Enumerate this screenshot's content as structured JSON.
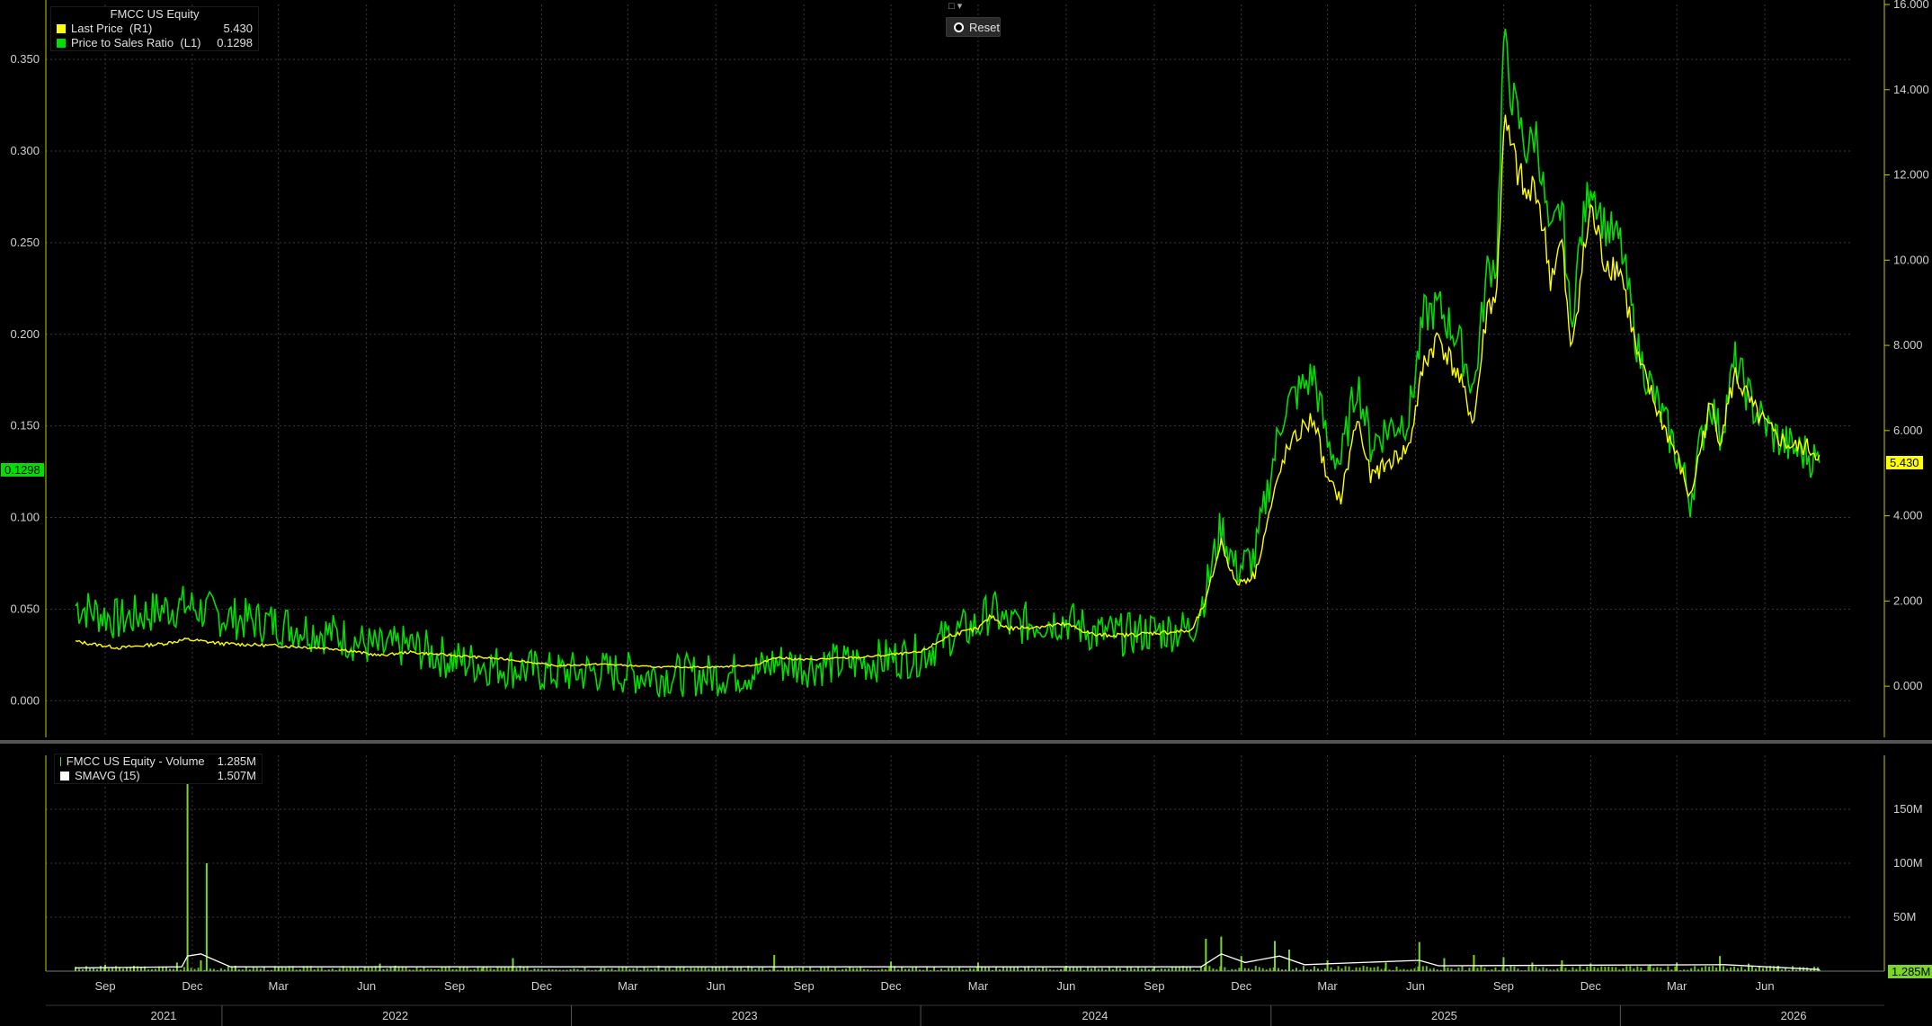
{
  "price_legend": {
    "title": "FMCC US Equity",
    "rows": [
      {
        "label": "Last Price  (R1)",
        "value": "5.430",
        "color": "#ffff00"
      },
      {
        "label": "Price to Sales Ratio  (L1)",
        "value": "0.1298",
        "color": "#00e000"
      }
    ]
  },
  "volume_legend": {
    "rows": [
      {
        "label": "FMCC US Equity - Volume",
        "value": "1.285M",
        "color": "#7cd62a"
      },
      {
        "label": "SMAVG (15)",
        "value": "1.507M",
        "color": "#ffffff"
      }
    ]
  },
  "toolbar": {
    "reset_label": "Reset"
  },
  "badges": {
    "left_value": "0.1298",
    "right_value": "5.430",
    "volume_value": "1.285M"
  },
  "colors": {
    "price": "#ffff00",
    "ps_ratio": "#00e000",
    "volume": "#7cd62a",
    "smavg": "#ffffff",
    "grid": "#3a3a3a",
    "axis": "#c8c800"
  },
  "chart_data": [
    {
      "type": "line",
      "series": [
        {
          "name": "Last Price  (R1)",
          "axis": "right",
          "points": [
            [
              "2021-08-01",
              1.05
            ],
            [
              "2021-09-15",
              0.9
            ],
            [
              "2021-11-01",
              1.0
            ],
            [
              "2021-11-25",
              1.1
            ],
            [
              "2022-01-01",
              1.0
            ],
            [
              "2022-03-01",
              0.95
            ],
            [
              "2022-05-01",
              0.88
            ],
            [
              "2022-06-15",
              0.72
            ],
            [
              "2022-07-15",
              0.8
            ],
            [
              "2022-09-01",
              0.72
            ],
            [
              "2022-11-01",
              0.62
            ],
            [
              "2022-12-15",
              0.48
            ],
            [
              "2023-02-01",
              0.52
            ],
            [
              "2023-04-01",
              0.45
            ],
            [
              "2023-06-01",
              0.45
            ],
            [
              "2023-07-15",
              0.5
            ],
            [
              "2023-08-01",
              0.68
            ],
            [
              "2023-09-01",
              0.62
            ],
            [
              "2023-11-01",
              0.68
            ],
            [
              "2024-01-01",
              0.8
            ],
            [
              "2024-02-01",
              1.2
            ],
            [
              "2024-03-01",
              1.35
            ],
            [
              "2024-03-15",
              1.65
            ],
            [
              "2024-04-01",
              1.35
            ],
            [
              "2024-05-01",
              1.4
            ],
            [
              "2024-06-01",
              1.45
            ],
            [
              "2024-07-01",
              1.2
            ],
            [
              "2024-08-01",
              1.2
            ],
            [
              "2024-09-01",
              1.25
            ],
            [
              "2024-10-10",
              1.3
            ],
            [
              "2024-10-25",
              2.0
            ],
            [
              "2024-11-10",
              3.4
            ],
            [
              "2024-11-25",
              2.4
            ],
            [
              "2024-12-15",
              2.6
            ],
            [
              "2025-01-01",
              4.2
            ],
            [
              "2025-01-15",
              5.4
            ],
            [
              "2025-02-01",
              6.0
            ],
            [
              "2025-02-15",
              6.3
            ],
            [
              "2025-03-01",
              4.8
            ],
            [
              "2025-03-15",
              4.4
            ],
            [
              "2025-04-01",
              6.3
            ],
            [
              "2025-04-15",
              4.9
            ],
            [
              "2025-05-01",
              5.2
            ],
            [
              "2025-05-25",
              5.6
            ],
            [
              "2025-06-10",
              7.6
            ],
            [
              "2025-06-25",
              8.2
            ],
            [
              "2025-07-15",
              7.3
            ],
            [
              "2025-08-01",
              6.2
            ],
            [
              "2025-08-15",
              8.9
            ],
            [
              "2025-08-25",
              9.2
            ],
            [
              "2025-09-01",
              13.2
            ],
            [
              "2025-09-10",
              12.5
            ],
            [
              "2025-09-25",
              11.4
            ],
            [
              "2025-10-05",
              11.8
            ],
            [
              "2025-10-20",
              9.6
            ],
            [
              "2025-11-01",
              10.4
            ],
            [
              "2025-11-10",
              7.8
            ],
            [
              "2025-11-20",
              9.5
            ],
            [
              "2025-12-01",
              11.2
            ],
            [
              "2025-12-15",
              10.0
            ],
            [
              "2026-01-01",
              9.8
            ],
            [
              "2026-01-20",
              7.6
            ],
            [
              "2026-02-10",
              6.4
            ],
            [
              "2026-03-01",
              5.4
            ],
            [
              "2026-03-15",
              4.4
            ],
            [
              "2026-03-25",
              5.5
            ],
            [
              "2026-04-05",
              6.6
            ],
            [
              "2026-04-15",
              5.8
            ],
            [
              "2026-05-01",
              7.3
            ],
            [
              "2026-05-20",
              6.5
            ],
            [
              "2026-06-10",
              5.9
            ],
            [
              "2026-07-01",
              5.6
            ],
            [
              "2026-07-15",
              5.6
            ],
            [
              "2026-07-28",
              5.43
            ]
          ]
        },
        {
          "name": "Price to Sales Ratio  (L1)",
          "axis": "left",
          "points": [
            [
              "2021-08-01",
              0.052
            ],
            [
              "2021-09-15",
              0.044
            ],
            [
              "2021-11-01",
              0.05
            ],
            [
              "2021-11-25",
              0.052
            ],
            [
              "2022-01-01",
              0.046
            ],
            [
              "2022-03-01",
              0.042
            ],
            [
              "2022-05-01",
              0.036
            ],
            [
              "2022-06-15",
              0.028
            ],
            [
              "2022-07-15",
              0.03
            ],
            [
              "2022-09-01",
              0.022
            ],
            [
              "2022-11-01",
              0.018
            ],
            [
              "2022-12-15",
              0.015
            ],
            [
              "2023-02-01",
              0.016
            ],
            [
              "2023-04-01",
              0.014
            ],
            [
              "2023-06-01",
              0.014
            ],
            [
              "2023-07-15",
              0.016
            ],
            [
              "2023-08-01",
              0.021
            ],
            [
              "2023-09-01",
              0.019
            ],
            [
              "2023-11-01",
              0.021
            ],
            [
              "2024-01-01",
              0.025
            ],
            [
              "2024-02-01",
              0.036
            ],
            [
              "2024-03-01",
              0.041
            ],
            [
              "2024-03-15",
              0.05
            ],
            [
              "2024-04-01",
              0.041
            ],
            [
              "2024-05-01",
              0.043
            ],
            [
              "2024-06-01",
              0.044
            ],
            [
              "2024-07-01",
              0.037
            ],
            [
              "2024-08-01",
              0.036
            ],
            [
              "2024-09-01",
              0.038
            ],
            [
              "2024-10-10",
              0.039
            ],
            [
              "2024-10-25",
              0.06
            ],
            [
              "2024-11-10",
              0.095
            ],
            [
              "2024-11-25",
              0.072
            ],
            [
              "2024-12-15",
              0.078
            ],
            [
              "2025-01-01",
              0.125
            ],
            [
              "2025-01-15",
              0.16
            ],
            [
              "2025-02-01",
              0.17
            ],
            [
              "2025-02-15",
              0.178
            ],
            [
              "2025-03-01",
              0.14
            ],
            [
              "2025-03-15",
              0.13
            ],
            [
              "2025-04-01",
              0.175
            ],
            [
              "2025-04-15",
              0.14
            ],
            [
              "2025-05-01",
              0.148
            ],
            [
              "2025-05-25",
              0.155
            ],
            [
              "2025-06-10",
              0.21
            ],
            [
              "2025-06-25",
              0.215
            ],
            [
              "2025-07-15",
              0.198
            ],
            [
              "2025-08-01",
              0.17
            ],
            [
              "2025-08-15",
              0.235
            ],
            [
              "2025-08-25",
              0.24
            ],
            [
              "2025-09-01",
              0.36
            ],
            [
              "2025-09-10",
              0.33
            ],
            [
              "2025-09-25",
              0.3
            ],
            [
              "2025-10-05",
              0.31
            ],
            [
              "2025-10-20",
              0.25
            ],
            [
              "2025-11-01",
              0.272
            ],
            [
              "2025-11-10",
              0.205
            ],
            [
              "2025-11-20",
              0.25
            ],
            [
              "2025-12-01",
              0.285
            ],
            [
              "2025-12-15",
              0.26
            ],
            [
              "2026-01-01",
              0.25
            ],
            [
              "2026-01-20",
              0.19
            ],
            [
              "2026-02-10",
              0.16
            ],
            [
              "2026-03-01",
              0.135
            ],
            [
              "2026-03-15",
              0.11
            ],
            [
              "2026-03-25",
              0.138
            ],
            [
              "2026-04-05",
              0.165
            ],
            [
              "2026-04-15",
              0.145
            ],
            [
              "2026-05-01",
              0.185
            ],
            [
              "2026-05-20",
              0.16
            ],
            [
              "2026-06-10",
              0.145
            ],
            [
              "2026-07-01",
              0.137
            ],
            [
              "2026-07-15",
              0.135
            ],
            [
              "2026-07-28",
              0.1298
            ]
          ]
        }
      ],
      "left_axis": {
        "range": [
          -0.02,
          0.38
        ],
        "ticks": [
          "0.000",
          "0.050",
          "0.100",
          "0.150",
          "0.200",
          "0.250",
          "0.300",
          "0.350"
        ]
      },
      "right_axis": {
        "range": [
          -1.2,
          16.0
        ],
        "ticks": [
          "0.000",
          "2.000",
          "4.000",
          "6.000",
          "8.000",
          "10.000",
          "12.000",
          "14.000",
          "16.000"
        ]
      },
      "x_range": [
        "2021-07-01",
        "2026-08-31"
      ],
      "x_month_labels": [
        [
          "2021-09-01",
          "Sep"
        ],
        [
          "2021-12-01",
          "Dec"
        ],
        [
          "2022-03-01",
          "Mar"
        ],
        [
          "2022-06-01",
          "Jun"
        ],
        [
          "2022-09-01",
          "Sep"
        ],
        [
          "2022-12-01",
          "Dec"
        ],
        [
          "2023-03-01",
          "Mar"
        ],
        [
          "2023-06-01",
          "Jun"
        ],
        [
          "2023-09-01",
          "Sep"
        ],
        [
          "2023-12-01",
          "Dec"
        ],
        [
          "2024-03-01",
          "Mar"
        ],
        [
          "2024-06-01",
          "Jun"
        ],
        [
          "2024-09-01",
          "Sep"
        ],
        [
          "2024-12-01",
          "Dec"
        ],
        [
          "2025-03-01",
          "Mar"
        ],
        [
          "2025-06-01",
          "Jun"
        ],
        [
          "2025-09-01",
          "Sep"
        ],
        [
          "2025-12-01",
          "Dec"
        ],
        [
          "2026-03-01",
          "Mar"
        ],
        [
          "2026-06-01",
          "Jun"
        ]
      ],
      "x_year_labels": [
        [
          "2021-11-01",
          "2021"
        ],
        [
          "2022-07-01",
          "2022"
        ],
        [
          "2023-07-01",
          "2023"
        ],
        [
          "2024-07-01",
          "2024"
        ],
        [
          "2025-07-01",
          "2025"
        ],
        [
          "2026-07-01",
          "2026"
        ]
      ],
      "grid": true,
      "legend_placement": "top-left"
    },
    {
      "type": "bar",
      "series": [
        {
          "name": "FMCC US Equity - Volume",
          "points": [
            [
              "2021-08-01",
              4
            ],
            [
              "2021-09-01",
              6
            ],
            [
              "2021-10-01",
              5
            ],
            [
              "2021-11-15",
              8
            ],
            [
              "2021-11-26",
              185
            ],
            [
              "2021-12-10",
              10
            ],
            [
              "2021-12-16",
              100
            ],
            [
              "2022-01-15",
              5
            ],
            [
              "2022-03-01",
              3
            ],
            [
              "2022-06-15",
              7
            ],
            [
              "2022-07-01",
              5
            ],
            [
              "2022-10-01",
              4
            ],
            [
              "2022-11-01",
              12
            ],
            [
              "2023-02-01",
              3
            ],
            [
              "2023-06-01",
              4
            ],
            [
              "2023-08-01",
              15
            ],
            [
              "2023-12-01",
              9
            ],
            [
              "2024-03-01",
              8
            ],
            [
              "2024-06-01",
              5
            ],
            [
              "2024-09-01",
              4
            ],
            [
              "2024-10-25",
              30
            ],
            [
              "2024-11-10",
              32
            ],
            [
              "2024-12-01",
              14
            ],
            [
              "2025-01-05",
              28
            ],
            [
              "2025-01-20",
              20
            ],
            [
              "2025-03-01",
              10
            ],
            [
              "2025-05-01",
              8
            ],
            [
              "2025-06-05",
              27
            ],
            [
              "2025-07-01",
              12
            ],
            [
              "2025-08-01",
              15
            ],
            [
              "2025-09-01",
              13
            ],
            [
              "2025-10-01",
              8
            ],
            [
              "2025-11-01",
              10
            ],
            [
              "2025-12-01",
              7
            ],
            [
              "2026-02-01",
              6
            ],
            [
              "2026-03-01",
              8
            ],
            [
              "2026-04-15",
              14
            ],
            [
              "2026-05-15",
              7
            ],
            [
              "2026-06-15",
              5
            ],
            [
              "2026-07-28",
              1.285
            ]
          ]
        },
        {
          "name": "SMAVG (15)",
          "points": [
            [
              "2021-08-01",
              3
            ],
            [
              "2021-11-20",
              4
            ],
            [
              "2021-11-26",
              14
            ],
            [
              "2021-12-10",
              16
            ],
            [
              "2021-12-20",
              12
            ],
            [
              "2022-01-10",
              4
            ],
            [
              "2024-10-20",
              4
            ],
            [
              "2024-11-10",
              16
            ],
            [
              "2024-12-05",
              8
            ],
            [
              "2025-01-10",
              14
            ],
            [
              "2025-02-05",
              6
            ],
            [
              "2025-06-05",
              10
            ],
            [
              "2025-06-25",
              5
            ],
            [
              "2026-04-20",
              6
            ],
            [
              "2026-07-28",
              1.507
            ]
          ]
        }
      ],
      "y_axis": {
        "range": [
          0,
          200
        ],
        "ticks": [
          "50M",
          "100M",
          "150M"
        ]
      },
      "grid": true,
      "legend_placement": "top-left"
    }
  ]
}
